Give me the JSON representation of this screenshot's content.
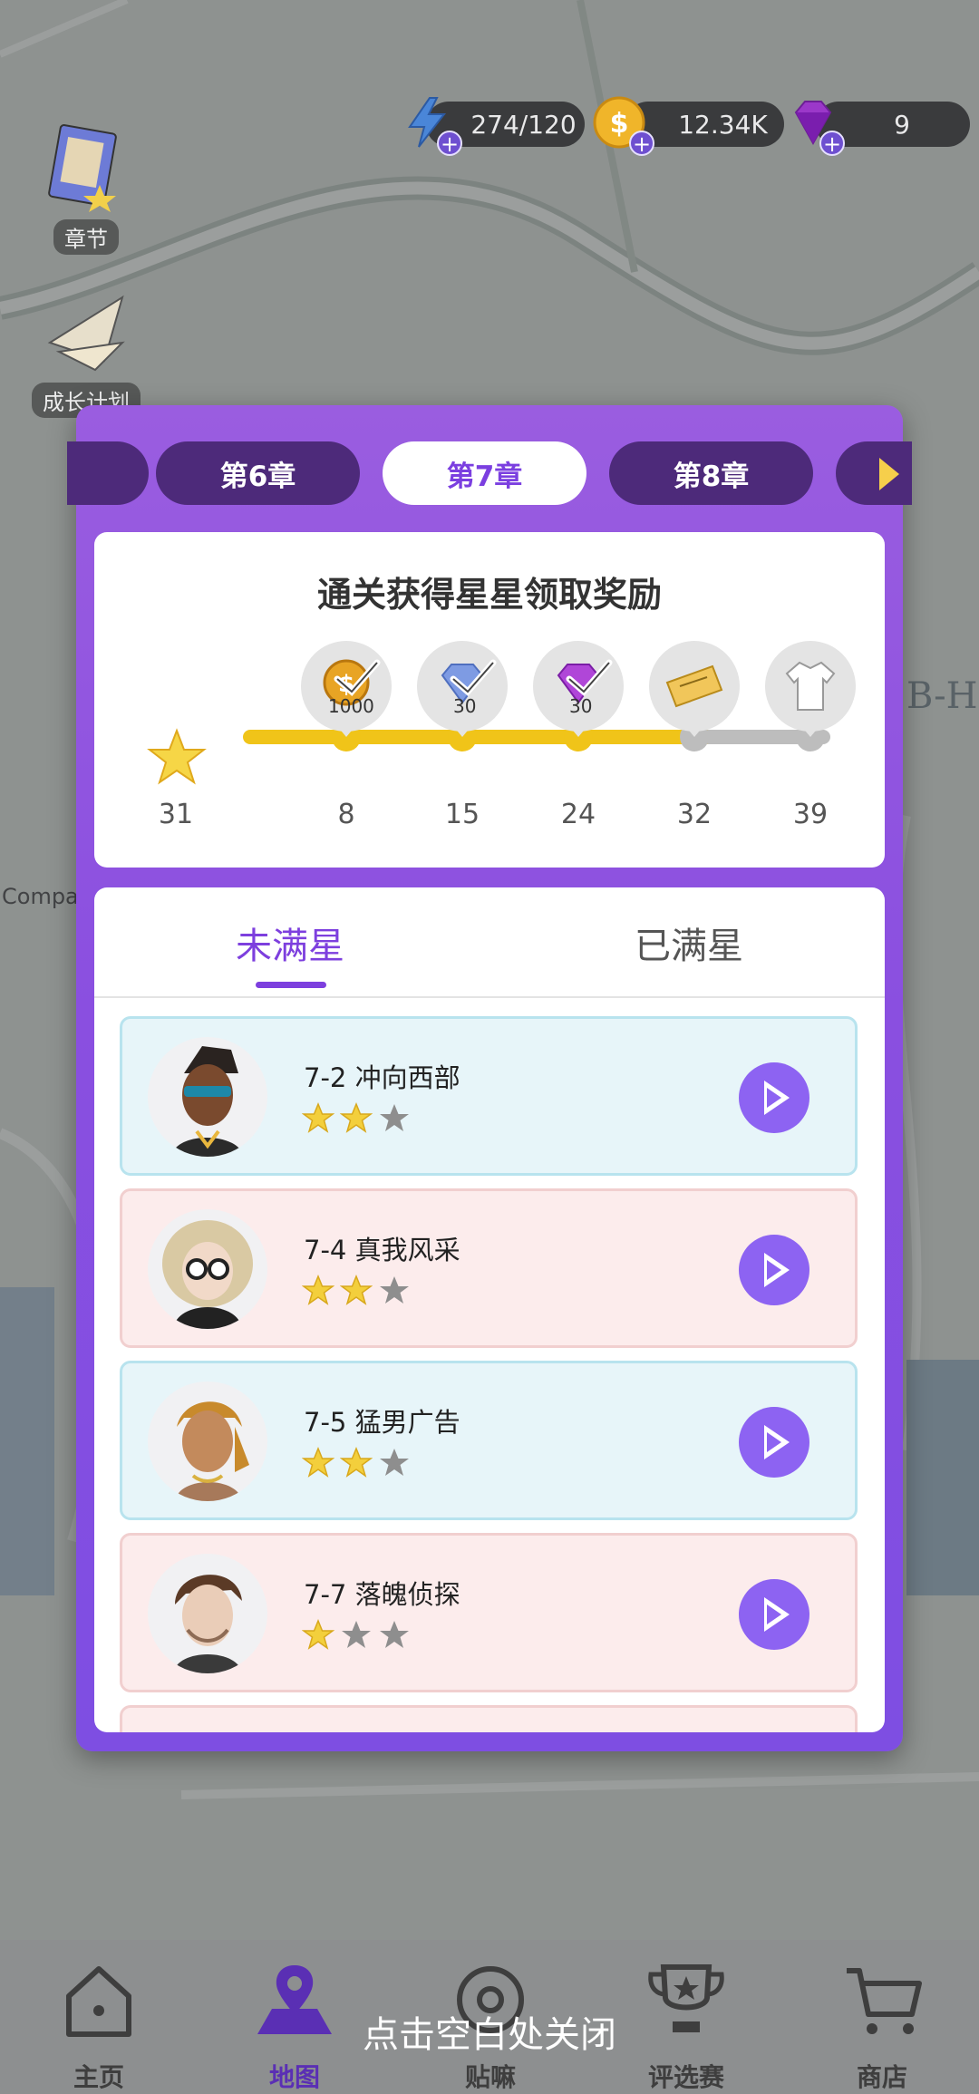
{
  "resources": {
    "energy": "274/120",
    "coins": "12.34K",
    "gems": "9"
  },
  "side_buttons": {
    "chapter_label": "章节",
    "growth_plan_label": "成长计划"
  },
  "map_labels": {
    "company": "Compan",
    "bh": "B-H"
  },
  "chapters": {
    "prev": "第6章",
    "current": "第7章",
    "next": "第8章"
  },
  "reward": {
    "title": "通关获得星星领取奖励",
    "current_stars": "31",
    "milestones": [
      {
        "stars": "8",
        "icon": "coin-reward-icon",
        "amount": "1000",
        "claimed": true
      },
      {
        "stars": "15",
        "icon": "diamond-blue-reward-icon",
        "amount": "30",
        "claimed": true
      },
      {
        "stars": "24",
        "icon": "gem-purple-reward-icon",
        "amount": "30",
        "claimed": true
      },
      {
        "stars": "32",
        "icon": "ticket-reward-icon",
        "amount": "",
        "claimed": false
      },
      {
        "stars": "39",
        "icon": "tshirt-reward-icon",
        "amount": "",
        "claimed": false
      }
    ],
    "progress_color": "#f0c419",
    "remaining_color": "#bdbdbd"
  },
  "tabs": {
    "unfull": "未满星",
    "full": "已满星"
  },
  "levels": [
    {
      "name": "7-2 冲向西部",
      "stars": 2,
      "theme": "blue"
    },
    {
      "name": "7-4 真我风采",
      "stars": 2,
      "theme": "pink"
    },
    {
      "name": "7-5 猛男广告",
      "stars": 2,
      "theme": "blue"
    },
    {
      "name": "7-7 落魄侦探",
      "stars": 1,
      "theme": "pink"
    }
  ],
  "nav": {
    "home": "主页",
    "map": "地图",
    "post": "贴嘛",
    "contest": "评选赛",
    "shop": "商店"
  },
  "close_hint": "点击空白处关闭"
}
